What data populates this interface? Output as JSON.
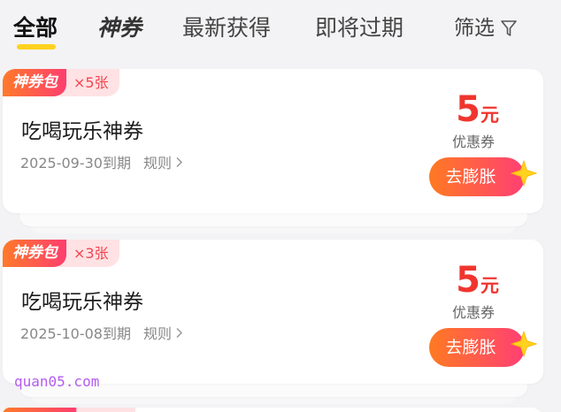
{
  "tabs": [
    {
      "label": "全部",
      "active": true
    },
    {
      "label": "神券",
      "active": false
    },
    {
      "label": "最新获得",
      "active": false
    },
    {
      "label": "即将过期",
      "active": false
    }
  ],
  "filter": {
    "label": "筛选",
    "icon": "filter-icon"
  },
  "coupons": [
    {
      "package_tag": "神券包",
      "count": "×5张",
      "title": "吃喝玩乐神券",
      "expiry": "2025-09-30到期",
      "rules_label": "规则",
      "amount": "5",
      "unit": "元",
      "amount_label": "优惠券",
      "button_label": "去膨胀"
    },
    {
      "package_tag": "神券包",
      "count": "×3张",
      "title": "吃喝玩乐神券",
      "expiry": "2025-10-08到期",
      "rules_label": "规则",
      "amount": "5",
      "unit": "元",
      "amount_label": "优惠券",
      "button_label": "去膨胀"
    }
  ],
  "watermark": "quan05.com",
  "colors": {
    "accent_yellow": "#ffd21f",
    "price_red": "#f0352e",
    "button_start": "#ff7a22",
    "button_end": "#ff3f74",
    "badge_pink": "#ffe2e4"
  }
}
